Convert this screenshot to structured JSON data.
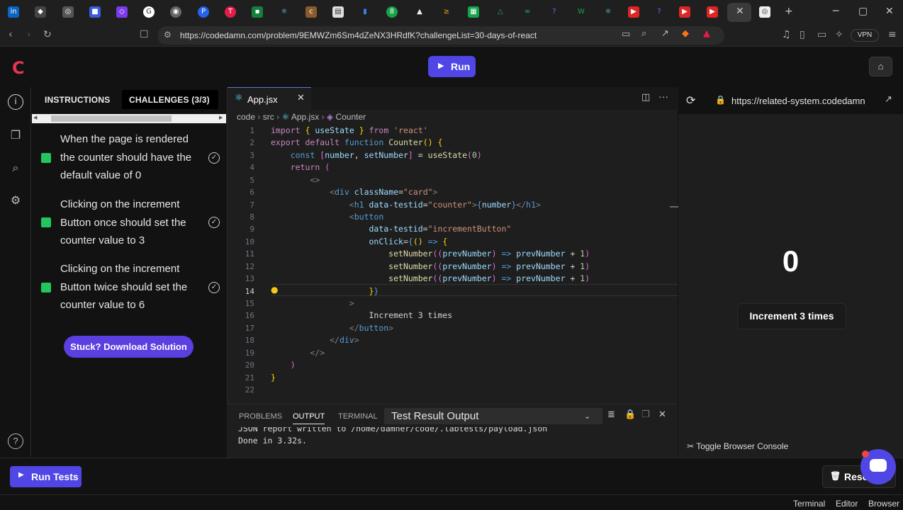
{
  "browser": {
    "url": "https://codedamn.com/problem/9EMWZm6Sm4dZeNX3HRdfK?challengeList=30-days-of-react",
    "vpn_label": "VPN",
    "tab_icons": [
      "linkedin-icon",
      "tab-icon",
      "tab-icon",
      "tab-icon",
      "tab-icon",
      "google-icon",
      "tab-icon",
      "tab-icon",
      "tab-icon",
      "tab-icon",
      "react-icon",
      "tab-icon",
      "tab-icon",
      "tab-icon",
      "tab-icon",
      "tab-icon",
      "tab-icon",
      "tab-icon",
      "tab-icon",
      "tab-icon",
      "tab-icon",
      "tab-icon",
      "tab-icon",
      "youtube-icon",
      "tab-icon",
      "youtube-icon",
      "youtube-icon"
    ]
  },
  "app": {
    "logo": "C",
    "run_label": "Run"
  },
  "instructions": {
    "tab_instructions": "INSTRUCTIONS",
    "tab_challenges": "CHALLENGES (3/3)",
    "challenges": [
      {
        "line1": "When the page is rendered",
        "line2": "the counter should have the",
        "line3": "default value of 0"
      },
      {
        "line1": "Clicking on the increment",
        "line2": "Button once should set the",
        "line3": "counter value to 3"
      },
      {
        "line1": "Clicking on the increment",
        "line2": "Button twice should set the",
        "line3": "counter value to 6"
      }
    ],
    "stuck_label": "Stuck? Download Solution"
  },
  "editor": {
    "tab_name": "App.jsx",
    "breadcrumb": {
      "a": "code",
      "b": "src",
      "c": "App.jsx",
      "d": "Counter"
    },
    "current_line": 14
  },
  "bottom_panel": {
    "tab_problems": "PROBLEMS",
    "tab_output": "OUTPUT",
    "tab_terminal": "TERMINAL",
    "output_select": "Test Result Output",
    "output_line1": "JSON report written to /home/damner/code/.labtests/payload.json",
    "output_line2": "Done in 3.32s."
  },
  "preview": {
    "url": "https://related-system.codedamn",
    "counter_value": "0",
    "button_label": "Increment 3 times",
    "toggle_console": "Toggle Browser Console"
  },
  "footer": {
    "run_tests": "Run Tests",
    "reset_lab": "Reset Lab",
    "status_terminal": "Terminal",
    "status_editor": "Editor",
    "status_browser": "Browser"
  }
}
